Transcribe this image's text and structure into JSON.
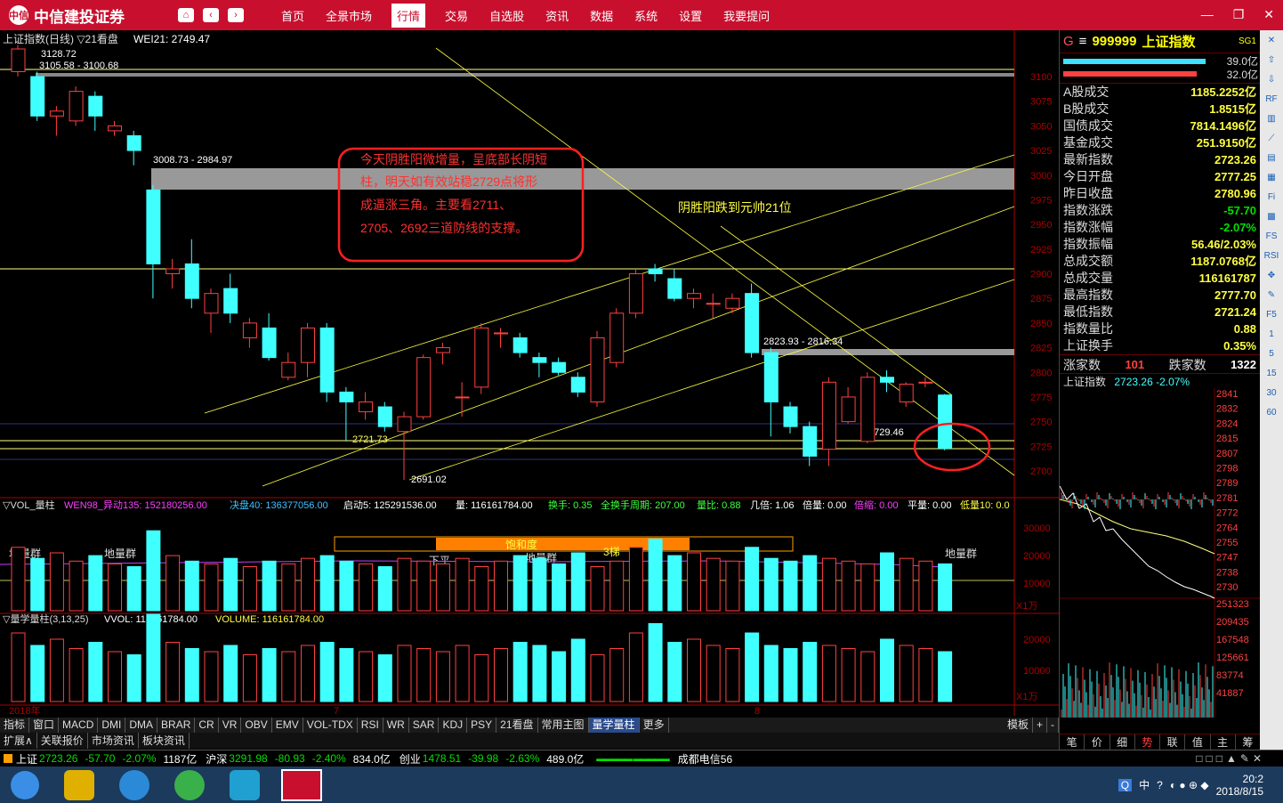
{
  "app": {
    "title": "中信建投证券",
    "logo": "中信"
  },
  "menu": [
    "首页",
    "全景市场",
    "行情",
    "交易",
    "自选股",
    "资讯",
    "数据",
    "系统",
    "设置",
    "我要提问"
  ],
  "window_controls": [
    "—",
    "❐",
    "✕"
  ],
  "chart_header": {
    "title": "上证指数(日线) ▽21看盘",
    "wei": "WEI21: 2749.47"
  },
  "price_labels": {
    "top": "3128.72",
    "band1": "3105.58 - 3100.68",
    "band2": "3008.73 - 2984.97",
    "band3": "2823.93 - 2816.34",
    "low1": "2721.73",
    "low2": "2691.02",
    "low3": "2729.46"
  },
  "annotations": {
    "box_text": [
      "今天阴胜阳微增量，呈底部长阴短",
      "柱，明天如有效站稳2729点将形",
      "成逼涨三角。主要看2711、",
      "2705、2692三道防线的支撑。"
    ],
    "note": "阴胜阳跌到元帅21位"
  },
  "y_axis": [
    "3100",
    "3075",
    "3050",
    "3025",
    "3000",
    "2975",
    "2950",
    "2925",
    "2900",
    "2875",
    "2850",
    "2825",
    "2800",
    "2775",
    "2750",
    "2725",
    "2700"
  ],
  "vol_header": {
    "label": "▽VOL_量柱",
    "wen": "WEN98_异动135: 152180256.00",
    "mid": "决盘40: 136377056.00",
    "qd": "启动5: 125291536.00",
    "liang": "量: 116161784.00",
    "hs": "换手: 0.35",
    "qhs": "全换手周期: 207.00",
    "lb": "量比: 0.88",
    "jb": "几倍: 1.06",
    "bl": "倍量: 0.00",
    "bs": "倍缩: 0.00",
    "pl": "平量: 0.00",
    "dl": "低量10: 0.0"
  },
  "vol_labels": {
    "dlq1": "地量群",
    "dlq2": "地量群",
    "xp": "下平",
    "bhd": "饱和度",
    "dlq3": "地量群",
    "st": "3梯",
    "dlq4": "地量群"
  },
  "vol_axis": [
    "30000",
    "20000",
    "10000",
    "X1万"
  ],
  "lx_header": {
    "label": "▽量学量柱(3,13,25)",
    "vvol": "VVOL: 116161784.00",
    "volume": "VOLUME: 116161784.00"
  },
  "lx_axis": [
    "20000",
    "10000",
    "X1万"
  ],
  "x_axis": [
    "2018年",
    "7",
    "8"
  ],
  "right": {
    "code": "999999",
    "name": "上证指数",
    "tag": "SG1",
    "bars": [
      "39.0亿",
      "32.0亿"
    ],
    "rows": [
      {
        "k": "A股成交",
        "v": "1185.2252亿",
        "c": ""
      },
      {
        "k": "B股成交",
        "v": "1.8515亿",
        "c": ""
      },
      {
        "k": "国债成交",
        "v": "7814.1496亿",
        "c": ""
      },
      {
        "k": "基金成交",
        "v": "251.9150亿",
        "c": ""
      },
      {
        "k": "最新指数",
        "v": "2723.26",
        "c": ""
      },
      {
        "k": "今日开盘",
        "v": "2777.25",
        "c": ""
      },
      {
        "k": "昨日收盘",
        "v": "2780.96",
        "c": ""
      },
      {
        "k": "指数涨跌",
        "v": "-57.70",
        "c": "dn"
      },
      {
        "k": "指数涨幅",
        "v": "-2.07%",
        "c": "dn"
      },
      {
        "k": "指数振幅",
        "v": "56.46/2.03%",
        "c": ""
      },
      {
        "k": "总成交额",
        "v": "1187.0768亿",
        "c": ""
      },
      {
        "k": "总成交量",
        "v": "116161787",
        "c": ""
      },
      {
        "k": "最高指数",
        "v": "2777.70",
        "c": ""
      },
      {
        "k": "最低指数",
        "v": "2721.24",
        "c": ""
      },
      {
        "k": "指数量比",
        "v": "0.88",
        "c": ""
      },
      {
        "k": "上证换手",
        "v": "0.35%",
        "c": ""
      }
    ],
    "up_label": "涨家数",
    "up": "101",
    "down_label": "跌家数",
    "down": "1322",
    "mini_title": "上证指数",
    "mini_val": "2723.26 -2.07%",
    "mini_axis": [
      "2841",
      "2832",
      "2824",
      "2815",
      "2807",
      "2798",
      "2789",
      "2781",
      "2772",
      "2764",
      "2755",
      "2747",
      "2738",
      "2730",
      "251323",
      "209435",
      "167548",
      "125661",
      "83774",
      "41887"
    ],
    "tabs": [
      "笔",
      "价",
      "细",
      "势",
      "联",
      "值",
      "主",
      "筹"
    ]
  },
  "toolbar_nums": [
    "1",
    "5",
    "15",
    "30",
    "60"
  ],
  "tabs1": [
    "指标",
    "窗口",
    "MACD",
    "DMI",
    "DMA",
    "BRAR",
    "CR",
    "VR",
    "OBV",
    "EMV",
    "VOL-TDX",
    "RSI",
    "WR",
    "SAR",
    "KDJ",
    "PSY",
    "21看盘",
    "常用主图",
    "量学量柱",
    "更多"
  ],
  "tabs1_right": [
    "模板",
    "+",
    "-"
  ],
  "tabs2": [
    "扩展∧",
    "关联报价",
    "市场资讯",
    "板块资讯"
  ],
  "status": {
    "sh": "上证",
    "sh_v": "2723.26",
    "sh_c": "-57.70",
    "sh_p": "-2.07%",
    "sh_a": "1187亿",
    "hs": "沪深",
    "hs_v": "3291.98",
    "hs_c": "-80.93",
    "hs_p": "-2.40%",
    "hs_a": "834.0亿",
    "cy": "创业",
    "cy_v": "1478.51",
    "cy_c": "-39.98",
    "cy_p": "-2.63%",
    "cy_a": "489.0亿",
    "server": "成都电信56"
  },
  "taskbar": {
    "ime": "中",
    "date": "2018/8/15",
    "time": "20:2"
  },
  "candles": [
    {
      "o": 3105,
      "c": 3128,
      "h": 3132,
      "l": 3100
    },
    {
      "o": 3100,
      "c": 3060,
      "h": 3105,
      "l": 3055
    },
    {
      "o": 3060,
      "c": 3065,
      "h": 3070,
      "l": 3040
    },
    {
      "o": 3055,
      "c": 3085,
      "h": 3090,
      "l": 3050
    },
    {
      "o": 3080,
      "c": 3060,
      "h": 3085,
      "l": 3045
    },
    {
      "o": 3045,
      "c": 3050,
      "h": 3055,
      "l": 3040
    },
    {
      "o": 3040,
      "c": 3025,
      "h": 3045,
      "l": 3010
    },
    {
      "o": 2985,
      "c": 2910,
      "h": 2990,
      "l": 2875
    },
    {
      "o": 2900,
      "c": 2905,
      "h": 2915,
      "l": 2885
    },
    {
      "o": 2910,
      "c": 2875,
      "h": 2935,
      "l": 2865
    },
    {
      "o": 2860,
      "c": 2880,
      "h": 2885,
      "l": 2840
    },
    {
      "o": 2885,
      "c": 2860,
      "h": 2900,
      "l": 2850
    },
    {
      "o": 2835,
      "c": 2850,
      "h": 2855,
      "l": 2825
    },
    {
      "o": 2845,
      "c": 2815,
      "h": 2860,
      "l": 2812
    },
    {
      "o": 2795,
      "c": 2810,
      "h": 2820,
      "l": 2792
    },
    {
      "o": 2810,
      "c": 2845,
      "h": 2850,
      "l": 2795
    },
    {
      "o": 2845,
      "c": 2780,
      "h": 2850,
      "l": 2770
    },
    {
      "o": 2780,
      "c": 2770,
      "h": 2785,
      "l": 2730
    },
    {
      "o": 2760,
      "c": 2770,
      "h": 2780,
      "l": 2752
    },
    {
      "o": 2765,
      "c": 2745,
      "h": 2770,
      "l": 2740
    },
    {
      "o": 2740,
      "c": 2755,
      "h": 2760,
      "l": 2691
    },
    {
      "o": 2755,
      "c": 2815,
      "h": 2818,
      "l": 2752
    },
    {
      "o": 2820,
      "c": 2825,
      "h": 2830,
      "l": 2808
    },
    {
      "o": 2775,
      "c": 2775,
      "h": 2790,
      "l": 2755
    },
    {
      "o": 2785,
      "c": 2845,
      "h": 2850,
      "l": 2778
    },
    {
      "o": 2840,
      "c": 2840,
      "h": 2845,
      "l": 2825
    },
    {
      "o": 2835,
      "c": 2820,
      "h": 2840,
      "l": 2815
    },
    {
      "o": 2815,
      "c": 2810,
      "h": 2820,
      "l": 2795
    },
    {
      "o": 2810,
      "c": 2800,
      "h": 2815,
      "l": 2797
    },
    {
      "o": 2795,
      "c": 2780,
      "h": 2800,
      "l": 2775
    },
    {
      "o": 2770,
      "c": 2835,
      "h": 2842,
      "l": 2765
    },
    {
      "o": 2810,
      "c": 2860,
      "h": 2865,
      "l": 2805
    },
    {
      "o": 2860,
      "c": 2900,
      "h": 2905,
      "l": 2855
    },
    {
      "o": 2905,
      "c": 2900,
      "h": 2910,
      "l": 2892
    },
    {
      "o": 2895,
      "c": 2875,
      "h": 2905,
      "l": 2872
    },
    {
      "o": 2875,
      "c": 2880,
      "h": 2885,
      "l": 2865
    },
    {
      "o": 2870,
      "c": 2870,
      "h": 2880,
      "l": 2855
    },
    {
      "o": 2865,
      "c": 2875,
      "h": 2880,
      "l": 2860
    },
    {
      "o": 2880,
      "c": 2820,
      "h": 2890,
      "l": 2815
    },
    {
      "o": 2820,
      "c": 2770,
      "h": 2825,
      "l": 2735
    },
    {
      "o": 2765,
      "c": 2745,
      "h": 2770,
      "l": 2738
    },
    {
      "o": 2745,
      "c": 2715,
      "h": 2750,
      "l": 2705
    },
    {
      "o": 2722,
      "c": 2790,
      "h": 2795,
      "l": 2705
    },
    {
      "o": 2750,
      "c": 2775,
      "h": 2785,
      "l": 2748
    },
    {
      "o": 2730,
      "c": 2795,
      "h": 2800,
      "l": 2728
    },
    {
      "o": 2795,
      "c": 2790,
      "h": 2802,
      "l": 2780
    },
    {
      "o": 2770,
      "c": 2788,
      "h": 2790,
      "l": 2765
    },
    {
      "o": 2790,
      "c": 2790,
      "h": 2795,
      "l": 2785
    },
    {
      "o": 2777,
      "c": 2723,
      "h": 2778,
      "l": 2721
    }
  ],
  "volumes": [
    22,
    18,
    20,
    17,
    19,
    16,
    15,
    28,
    19,
    17,
    16,
    18,
    15,
    17,
    16,
    18,
    19,
    17,
    16,
    15,
    18,
    17,
    16,
    18,
    15,
    17,
    19,
    18,
    16,
    20,
    15,
    17,
    22,
    25,
    19,
    20,
    18,
    17,
    22,
    18,
    17,
    19,
    18,
    17,
    16,
    20,
    18,
    17,
    16
  ]
}
